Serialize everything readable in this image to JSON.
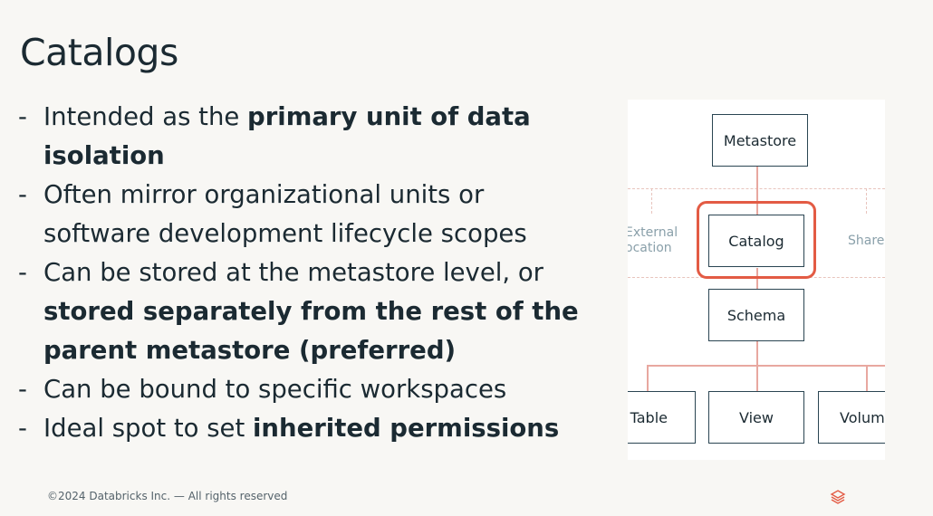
{
  "slide": {
    "title": "Catalogs",
    "bullets": [
      {
        "segments": [
          {
            "text": "Intended as the ",
            "bold": false
          },
          {
            "text": "primary unit of data isolation",
            "bold": true
          }
        ]
      },
      {
        "segments": [
          {
            "text": "Often mirror organizational units or software development lifecycle scopes",
            "bold": false
          }
        ]
      },
      {
        "segments": [
          {
            "text": "Can be stored at the metastore level, or ",
            "bold": false
          },
          {
            "text": "stored separately from the rest of the parent metastore (preferred)",
            "bold": true
          }
        ]
      },
      {
        "segments": [
          {
            "text": "Can be bound to specific workspaces",
            "bold": false
          }
        ]
      },
      {
        "segments": [
          {
            "text": "Ideal spot to set ",
            "bold": false
          },
          {
            "text": "inherited permissions",
            "bold": true
          }
        ]
      }
    ],
    "bullet_marker": "-"
  },
  "diagram": {
    "metastore": "Metastore",
    "catalog": "Catalog",
    "schema": "Schema",
    "external_location_line1": "External",
    "external_location_line2": "ocation",
    "share": "Share",
    "table": "Table",
    "view": "View",
    "volume": "Volum",
    "highlight_color": "#e35b44",
    "connector_color": "#e8a8a0"
  },
  "footer": {
    "copyright": "©2024 Databricks Inc. — All rights reserved",
    "logo_icon": "databricks-logo-icon",
    "logo_color": "#e35b44"
  }
}
